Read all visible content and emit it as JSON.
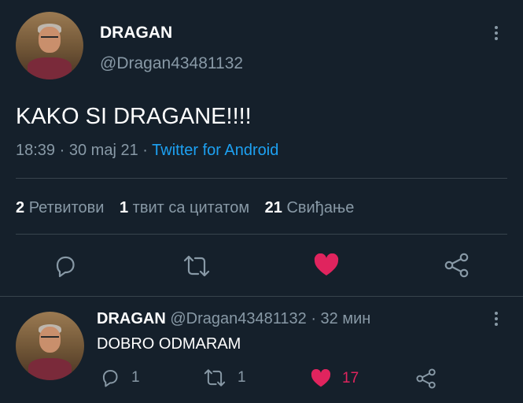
{
  "tweet": {
    "display_name": "DRAGAN",
    "handle": "@Dragan43481132",
    "text": "KAKO SI DRAGANE!!!!",
    "time": "18:39",
    "date": "30 maj 21",
    "source": "Twitter for Android",
    "sep": "·",
    "retweets_count": "2",
    "retweets_label": "Ретвитови",
    "quotes_count": "1",
    "quotes_label": "твит са цитатом",
    "likes_count": "21",
    "likes_label": "Свиђање"
  },
  "reply": {
    "display_name": "DRAGAN",
    "handle": "@Dragan43481132",
    "age": "· 32 мин",
    "text": "DOBRO ODMARAM",
    "reply_count": "1",
    "retweet_count": "1",
    "like_count": "17"
  },
  "colors": {
    "background": "#15202b",
    "like_pink": "#e0245e",
    "link_blue": "#1da1f2",
    "muted": "#8899a6"
  },
  "icons": [
    "avatar",
    "more-icon",
    "reply-icon",
    "retweet-icon",
    "like-icon",
    "share-icon"
  ]
}
